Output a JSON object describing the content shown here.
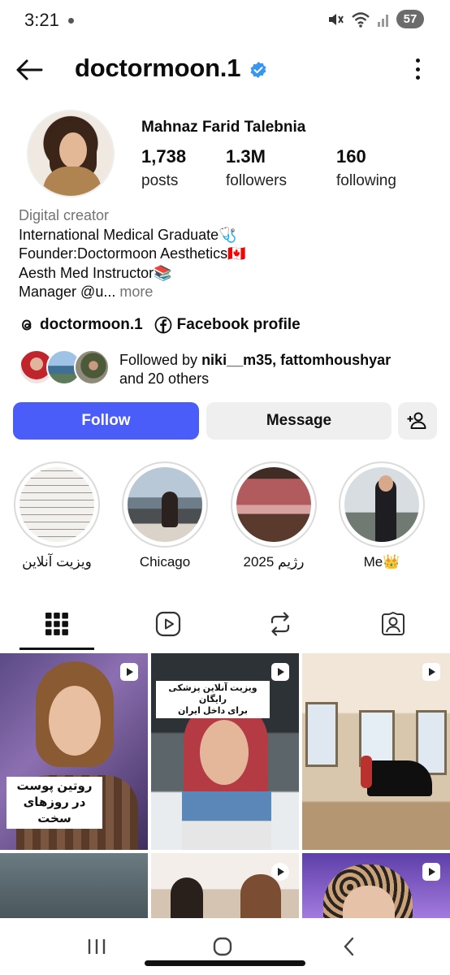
{
  "status_bar": {
    "time": "3:21",
    "battery": "57"
  },
  "header": {
    "username": "doctormoon.1"
  },
  "profile": {
    "full_name": "Mahnaz Farid Talebnia",
    "stats": [
      {
        "value": "1,738",
        "label": "posts"
      },
      {
        "value": "1.3M",
        "label": "followers"
      },
      {
        "value": "160",
        "label": "following"
      }
    ],
    "category": "Digital creator",
    "bio_lines": [
      "International Medical Graduate🩺",
      "Founder:Doctormoon Aesthetics🇨🇦",
      "Aesth Med Instructor📚",
      "Manager @u..."
    ],
    "more": "more",
    "links": [
      {
        "icon": "threads-icon",
        "text": "doctormoon.1"
      },
      {
        "icon": "facebook-icon",
        "text": "Facebook profile"
      }
    ],
    "followed_by": {
      "prefix": "Followed by",
      "names": "niki__m35, fattomhoushyar",
      "suffix": "and 20 others"
    }
  },
  "actions": {
    "follow": "Follow",
    "message": "Message"
  },
  "highlights": [
    {
      "label": "ویزیت آنلاین"
    },
    {
      "label": "Chicago"
    },
    {
      "label": "رژیم 2025"
    },
    {
      "label": "Me👑"
    }
  ],
  "tabs": [
    {
      "icon": "grid-icon",
      "active": true
    },
    {
      "icon": "reels-icon",
      "active": false
    },
    {
      "icon": "reposts-icon",
      "active": false
    },
    {
      "icon": "tagged-icon",
      "active": false
    }
  ],
  "posts": [
    {
      "caption": "روتین پوست\nدر روزهای سخت"
    },
    {
      "caption": "ویزیت آنلاین پزشکی رایگان\nبرای داخل ایران"
    }
  ],
  "colors": {
    "follow_button": "#4a5df9",
    "verified": "#3797f0"
  }
}
